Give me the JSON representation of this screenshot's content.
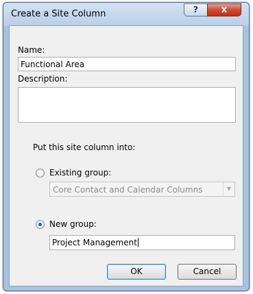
{
  "window": {
    "title": "Create a Site Column",
    "help_label": "?",
    "close_label": "x"
  },
  "form": {
    "name_label": "Name:",
    "name_value": "Functional Area",
    "description_label": "Description:",
    "description_value": "",
    "put_into_label": "Put this site column into:",
    "existing_group": {
      "label": "Existing group:",
      "selected": false,
      "selected_value": "Core Contact and Calendar Columns"
    },
    "new_group": {
      "label": "New group:",
      "selected": true,
      "value": "Project Management"
    }
  },
  "buttons": {
    "ok": "OK",
    "cancel": "Cancel"
  },
  "icons": {
    "dropdown_arrow": "chevron-down-icon"
  }
}
